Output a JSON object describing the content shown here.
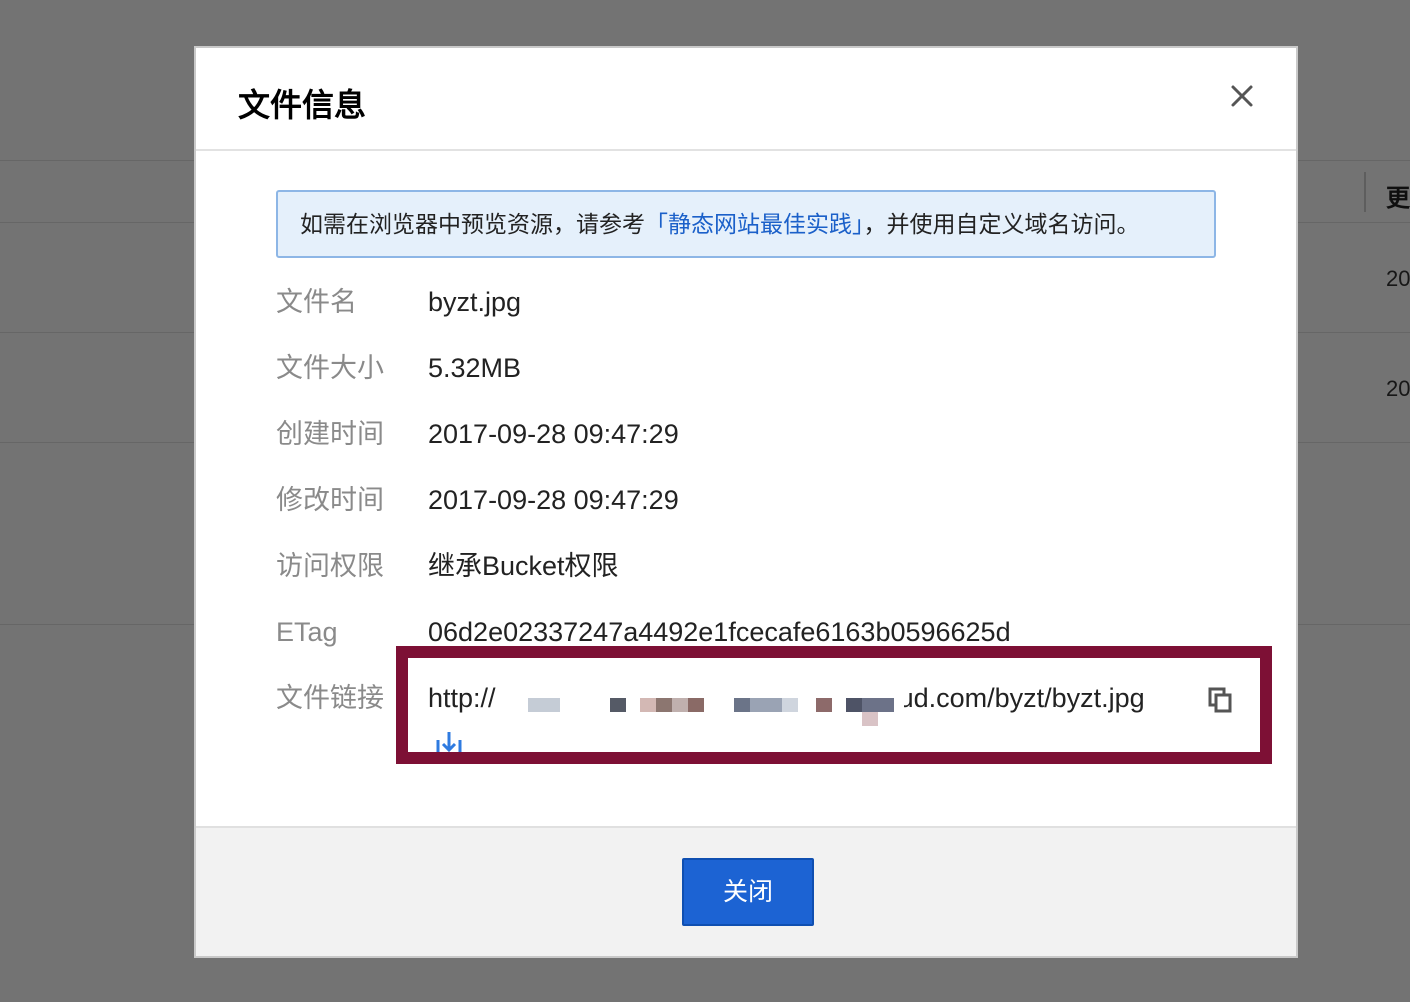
{
  "background": {
    "header_fragment": "更",
    "row_fragments": [
      "20",
      "20"
    ]
  },
  "dialog": {
    "title": "文件信息",
    "close_icon": "close-icon",
    "notice": {
      "text_before": "如需在浏览器中预览资源，请参考",
      "link_text": "「静态网站最佳实践」",
      "text_after": "，并使用自定义域名访问。"
    },
    "fields": [
      {
        "label": "文件名",
        "value": "byzt.jpg"
      },
      {
        "label": "文件大小",
        "value": "5.32MB"
      },
      {
        "label": "创建时间",
        "value": "2017-09-28 09:47:29"
      },
      {
        "label": "修改时间",
        "value": "2017-09-28 09:47:29"
      },
      {
        "label": "访问权限",
        "value": "继承Bucket权限"
      },
      {
        "label": "ETag",
        "value": "06d2e02337247a4492e1fcecafe6163b0596625d"
      }
    ],
    "file_link": {
      "label": "文件链接",
      "prefix": "http://",
      "suffix": "oud.com/byzt/byzt.jpg",
      "copy_icon": "copy-icon",
      "download_icon": "download-icon"
    },
    "footer": {
      "close_button": "关闭"
    }
  },
  "colors": {
    "primary": "#1c63d3",
    "link": "#1b60c9",
    "highlight_border": "#7d1035",
    "notice_bg": "#e5f0fb",
    "label_gray": "#8a8a8a"
  }
}
